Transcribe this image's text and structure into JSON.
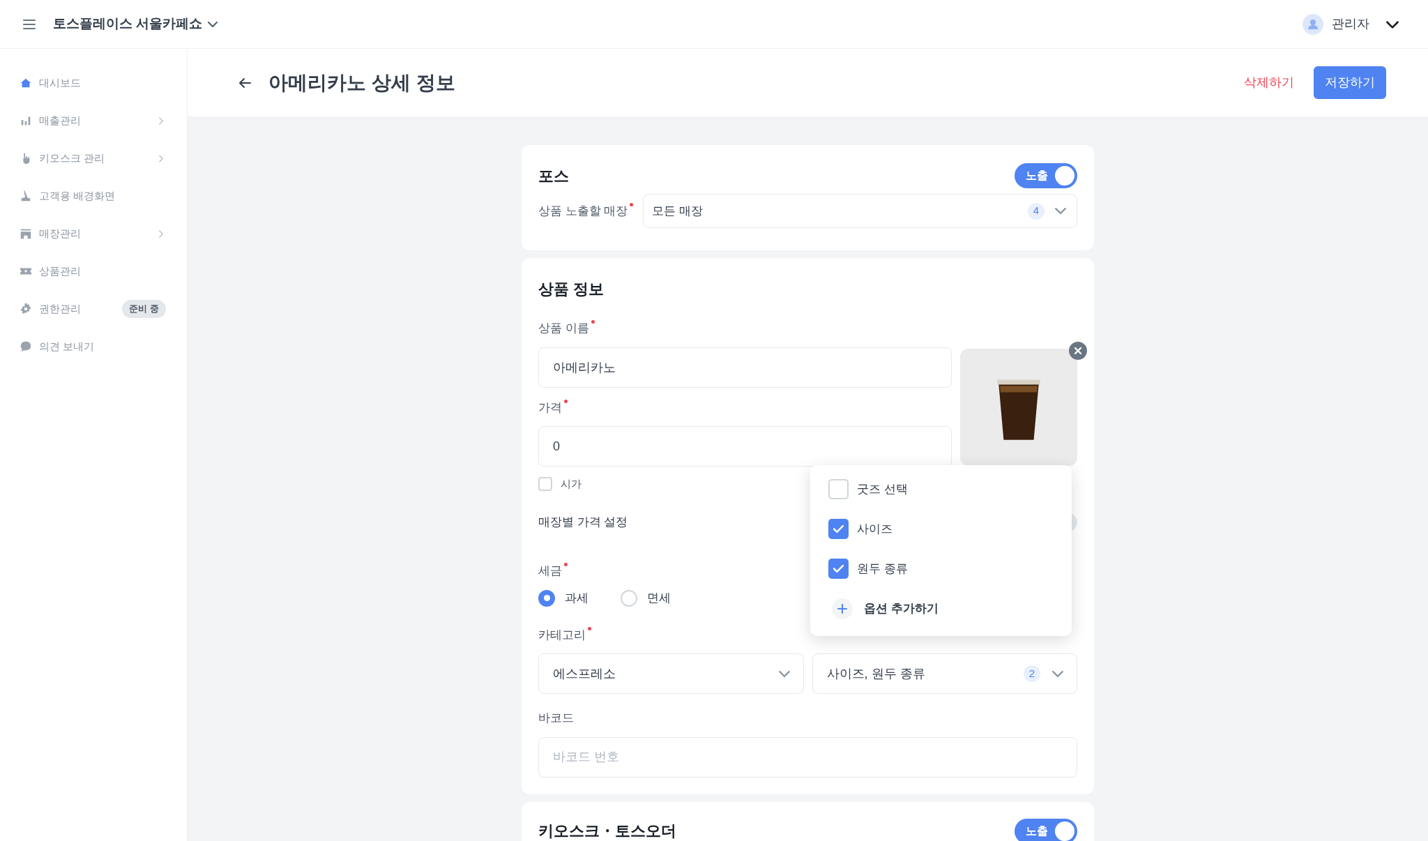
{
  "header": {
    "store_name": "토스플레이스 서울카페쇼",
    "user": "관리자"
  },
  "sidebar": {
    "items": [
      {
        "label": "대시보드",
        "selected": true,
        "expandable": false
      },
      {
        "label": "매출관리",
        "selected": false,
        "expandable": true
      },
      {
        "label": "키오스크 관리",
        "selected": false,
        "expandable": true
      },
      {
        "label": "고객용 배경화면",
        "selected": false,
        "expandable": false
      },
      {
        "label": "매장관리",
        "selected": false,
        "expandable": true
      },
      {
        "label": "상품관리",
        "selected": false,
        "expandable": false
      },
      {
        "label": "권한관리",
        "selected": false,
        "expandable": false,
        "badge": "준비 중"
      },
      {
        "label": "의견 보내기",
        "selected": false,
        "expandable": false
      }
    ]
  },
  "page": {
    "title": "아메리카노 상세 정보",
    "delete_button": "삭제하기",
    "save_button": "저장하기"
  },
  "pos_section": {
    "title": "포스",
    "visibility_toggle": {
      "label": "노출",
      "on": true
    },
    "store_field": {
      "label": "상품 노출할 매장",
      "required": true,
      "value": "모든 매장",
      "count": "4"
    }
  },
  "product_info": {
    "title": "상품 정보",
    "name_field": {
      "label": "상품 이름",
      "required": true,
      "value": "아메리카노"
    },
    "price_field": {
      "label": "가격",
      "required": true,
      "value": "0"
    },
    "market_price": {
      "label": "시가",
      "checked": false
    },
    "store_price_label": "매장별 가격 설정",
    "store_price_toggle": {
      "on": false
    },
    "tax": {
      "label": "세금",
      "required": true,
      "options": [
        {
          "label": "과세",
          "selected": true
        },
        {
          "label": "면세",
          "selected": false
        }
      ]
    },
    "category": {
      "label": "카테고리",
      "required": true,
      "value": "에스프레소",
      "option_value": "사이즈, 원두 종류",
      "option_count": "2"
    },
    "barcode": {
      "label": "바코드",
      "placeholder": "바코드 번호"
    }
  },
  "option_popup": {
    "items": [
      {
        "label": "굿즈 선택",
        "checked": false
      },
      {
        "label": "사이즈",
        "checked": true
      },
      {
        "label": "원두 종류",
        "checked": true
      }
    ],
    "add_label": "옵션 추가하기"
  },
  "kiosk_section": {
    "title": "키오스크・토스오더",
    "visibility_toggle": {
      "label": "노출",
      "on": true
    }
  }
}
